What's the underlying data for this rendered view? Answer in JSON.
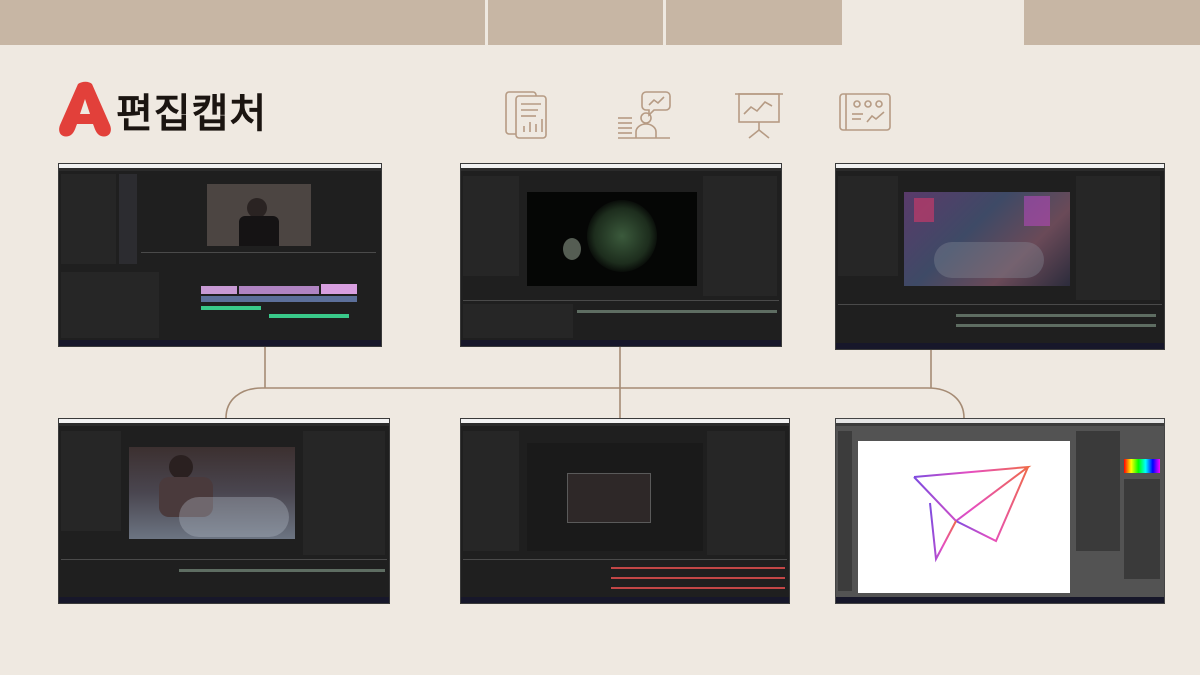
{
  "header": {
    "title": "편집캡처"
  },
  "colors": {
    "background": "#efe9e1",
    "topbar": "#c7b6a4",
    "accent_red": "#e2403a",
    "icon_stroke": "#b69b84",
    "connector": "#a58b74",
    "app_dark": "#1f1f1f"
  },
  "icons": [
    "document-chart-icon",
    "presenter-idea-icon",
    "presentation-board-icon",
    "dashboard-tablet-icon"
  ],
  "screenshots": [
    {
      "app": "premiere-pro"
    },
    {
      "app": "after-effects"
    },
    {
      "app": "after-effects"
    },
    {
      "app": "after-effects"
    },
    {
      "app": "after-effects"
    },
    {
      "app": "illustrator"
    }
  ]
}
